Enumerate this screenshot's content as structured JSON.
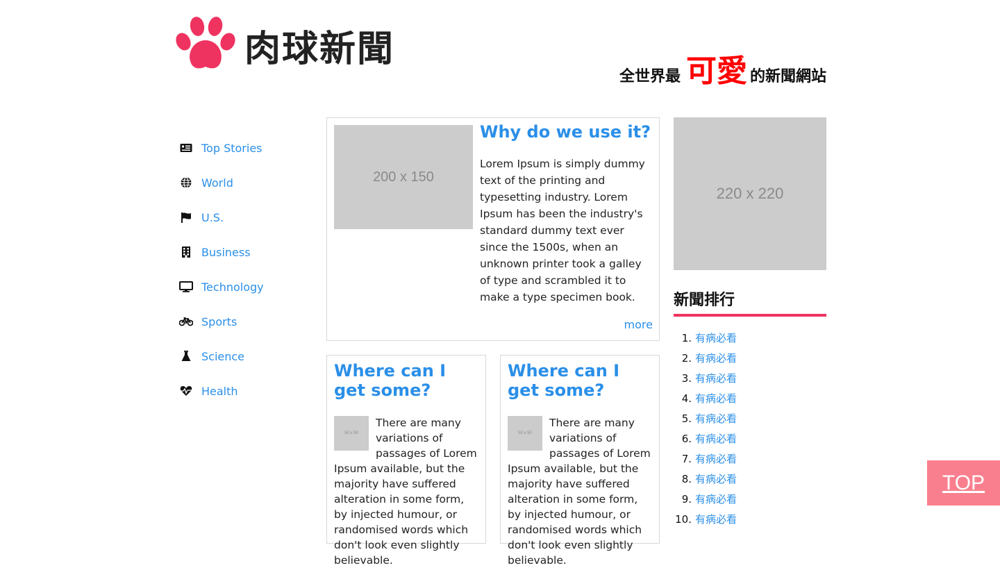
{
  "header": {
    "logo_text": "肉球新聞",
    "tagline_prefix": "全世界最",
    "tagline_highlight": "可愛",
    "tagline_suffix": "的新聞網站"
  },
  "nav": {
    "items": [
      {
        "label": "Top Stories",
        "icon": "newspaper-icon"
      },
      {
        "label": "World",
        "icon": "globe-icon"
      },
      {
        "label": "U.S.",
        "icon": "flag-icon"
      },
      {
        "label": "Business",
        "icon": "building-icon"
      },
      {
        "label": "Technology",
        "icon": "monitor-icon"
      },
      {
        "label": "Sports",
        "icon": "bicycle-icon"
      },
      {
        "label": "Science",
        "icon": "flask-icon"
      },
      {
        "label": "Health",
        "icon": "heartbeat-icon"
      }
    ]
  },
  "main": {
    "feature": {
      "image_placeholder": "200 x 150",
      "title": "Why do we use it?",
      "body": "Lorem Ipsum is simply dummy text of the printing and typesetting industry. Lorem Ipsum has been the industry's standard dummy text ever since the 1500s, when an unknown printer took a galley of type and scrambled it to make a type specimen book.",
      "more_label": "more"
    },
    "cards": [
      {
        "title": "Where can I get some?",
        "thumb_placeholder": "50 x 50",
        "body": "There are many variations of passages of Lorem Ipsum available, but the majority have suffered alteration in some form, by injected humour, or randomised words which don't look even slightly believable."
      },
      {
        "title": "Where can I get some?",
        "thumb_placeholder": "50 x 50",
        "body": "There are many variations of passages of Lorem Ipsum available, but the majority have suffered alteration in some form, by injected humour, or randomised words which don't look even slightly believable."
      }
    ]
  },
  "sidebar": {
    "ad_placeholder": "220 x 220",
    "ranking_title": "新聞排行",
    "ranking": [
      {
        "num": "1.",
        "label": "有病必看"
      },
      {
        "num": "2.",
        "label": "有病必看"
      },
      {
        "num": "3.",
        "label": "有病必看"
      },
      {
        "num": "4.",
        "label": "有病必看"
      },
      {
        "num": "5.",
        "label": "有病必看"
      },
      {
        "num": "6.",
        "label": "有病必看"
      },
      {
        "num": "7.",
        "label": "有病必看"
      },
      {
        "num": "8.",
        "label": "有病必看"
      },
      {
        "num": "9.",
        "label": "有病必看"
      },
      {
        "num": "10.",
        "label": "有病必看"
      }
    ]
  },
  "top_button": {
    "label": "TOP"
  },
  "colors": {
    "link": "#2a8fe8",
    "accent": "#ef3360",
    "highlight": "#ff0000",
    "top_button": "#f97f8e",
    "placeholder": "#cccccc"
  }
}
